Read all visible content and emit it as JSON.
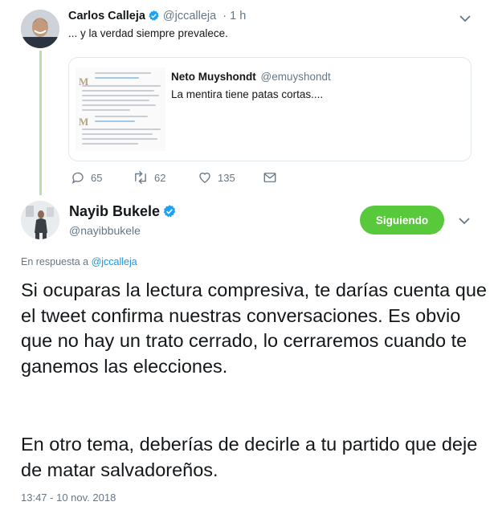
{
  "parent_tweet": {
    "author_name": "Carlos Calleja",
    "author_handle": "@jccalleja",
    "age": "· 1 h",
    "text": "... y la verdad siempre prevalece.",
    "quoted_tweet": {
      "author_name": "Neto Muyshondt",
      "author_handle": "@emuyshondt",
      "text": "La mentira tiene patas cortas...."
    },
    "actions": {
      "reply_count": "65",
      "retweet_count": "62",
      "like_count": "135"
    }
  },
  "main_tweet": {
    "author_name": "Nayib Bukele",
    "author_handle": "@nayibbukele",
    "follow_button_label": "Siguiendo",
    "reply_prefix": "En respuesta a",
    "reply_to_handle": "@jccalleja",
    "paragraphs": [
      "Si ocuparas la lectura compresiva, te darías cuenta que el tweet confirma nuestras conversaciones. Es obvio que no hay un trato cerrado, lo cerraremos cuando te ganemos las elecciones.",
      "En otro tema, deberías de decirle a tu partido que deje de matar salvadoreños."
    ],
    "timestamp": "13:47 - 10 nov. 2018"
  },
  "colors": {
    "verified": "#1da1f2",
    "follow_button": "#58c93a",
    "link": "#1b95e0",
    "secondary_text": "#657786",
    "thread_line": "#b5e2ad"
  },
  "icons": [
    "verified-badge-icon",
    "chevron-down-icon",
    "reply-icon",
    "retweet-icon",
    "like-icon",
    "message-icon"
  ]
}
